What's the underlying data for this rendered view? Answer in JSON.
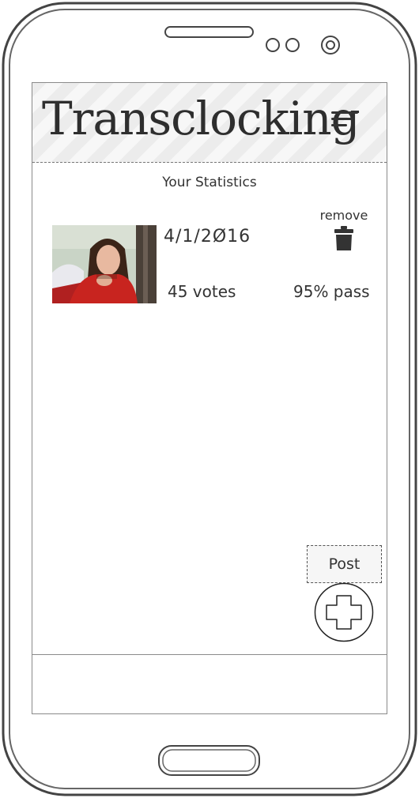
{
  "app": {
    "title": "Transclocking"
  },
  "page": {
    "section_title": "Your Statistics"
  },
  "stats": [
    {
      "date": "4/1/2Ø16",
      "votes": "45 votes",
      "pass": "95% pass",
      "remove_label": "remove"
    }
  ],
  "actions": {
    "post_label": "Post"
  },
  "icons": {
    "menu": "hamburger-menu-icon",
    "remove": "trash-icon",
    "add": "plus-icon",
    "camera": "camera-icon",
    "earpiece": "speaker-icon"
  },
  "colors": {
    "outline": "#2e2e2e",
    "hatch_light": "#f7f7f7",
    "hatch_dark": "#ececec"
  }
}
